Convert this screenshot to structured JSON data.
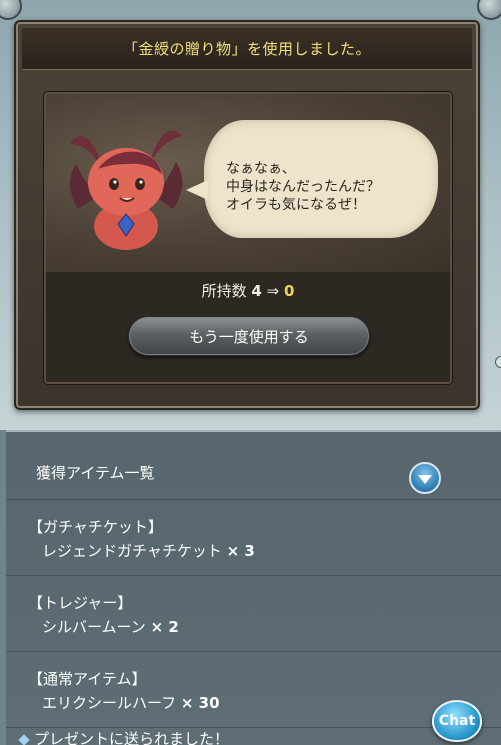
{
  "dialog": {
    "header_text": "「金綬の贈り物」を使用しました。",
    "speech": "なぁなぁ、\n中身はなんだったんだ？\nオイラも気になるぜ！",
    "count_label": "所持数",
    "count_before": "4",
    "arrow": "⇒",
    "count_after": "0",
    "reuse_button": "もう一度使用する"
  },
  "list": {
    "title": "獲得アイテム一覧",
    "items": [
      {
        "category": "【ガチャチケット】",
        "name": "レジェンドガチャチケット",
        "qty": "× 3"
      },
      {
        "category": "【トレジャー】",
        "name": "シルバームーン",
        "qty": "× 2"
      },
      {
        "category": "【通常アイテム】",
        "name": "エリクシールハーフ",
        "qty": "× 30"
      }
    ],
    "footer_note": "プレゼントに送られました！"
  },
  "chat_label": "Chat",
  "colors": {
    "header_text": "#f1e07a",
    "accent_blue": "#2c7ab0",
    "count_highlight": "#f1d35a"
  },
  "icons": {
    "toggle": "chevron-down-icon",
    "footer_bullet": "diamond-icon",
    "chat": "chat-bubble-icon"
  }
}
